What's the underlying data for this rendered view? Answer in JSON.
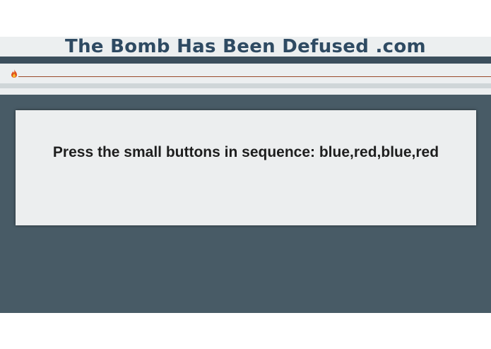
{
  "header": {
    "title": "The Bomb Has Been Defused .com"
  },
  "fuse": {
    "icon": "flame-icon"
  },
  "card": {
    "instruction": "Press the small buttons in sequence: blue,red,blue,red"
  },
  "colors": {
    "title": "#2e4a62",
    "main_background": "#485b66",
    "card_background": "#eceeef",
    "fuse_line": "#9a4a2a"
  }
}
